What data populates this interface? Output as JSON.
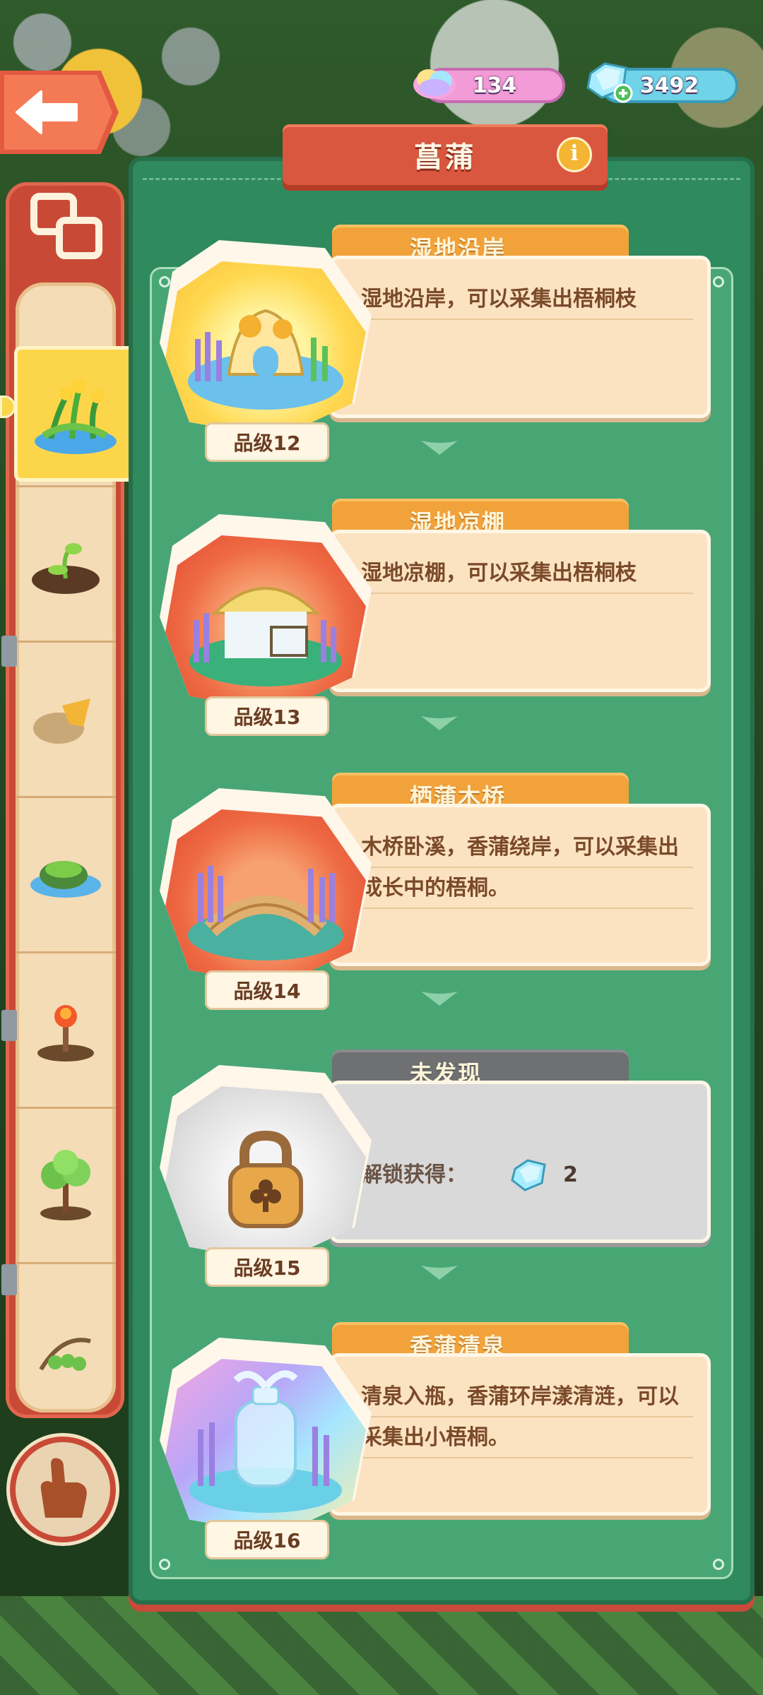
{
  "header": {
    "title": "菖蒲",
    "info_icon": "info-icon",
    "back_icon": "back-arrow-icon"
  },
  "currency": {
    "rainbow": "134",
    "gems": "3492"
  },
  "sidebar": {
    "items": [
      {
        "icon": "calamus-plant-icon",
        "active": true
      },
      {
        "icon": "sprout-soil-icon",
        "active": false
      },
      {
        "icon": "leaf-rock-icon",
        "active": false
      },
      {
        "icon": "moss-pond-icon",
        "active": false
      },
      {
        "icon": "fire-sapling-icon",
        "active": false
      },
      {
        "icon": "small-tree-icon",
        "active": false
      },
      {
        "icon": "berry-branch-icon",
        "active": false
      }
    ],
    "top_icon": "collection-icon",
    "bottom_icon": "hand-icon"
  },
  "cards": [
    {
      "name": "湿地沿岸",
      "desc": "湿地沿岸，可以采集出梧桐枝",
      "grade": "品级12",
      "locked": false
    },
    {
      "name": "湿地凉棚",
      "desc": "湿地凉棚，可以采集出梧桐枝",
      "grade": "品级13",
      "locked": false
    },
    {
      "name": "栖蒲木桥",
      "desc": "木桥卧溪，香蒲绕岸，可以采集出成长中的梧桐。",
      "grade": "品级14",
      "locked": false
    },
    {
      "name": "未发现",
      "desc": "解锁获得：",
      "reward": "2",
      "grade": "品级15",
      "locked": true
    },
    {
      "name": "香蒲清泉",
      "desc": "清泉入瓶，香蒲环岸漾清涟，可以采集出小梧桐。",
      "grade": "品级16",
      "locked": false
    }
  ],
  "colors": {
    "board": "#2f8a5e",
    "accent": "#d9573e",
    "tab": "#f2a23a",
    "panel": "#fbe3c2"
  }
}
